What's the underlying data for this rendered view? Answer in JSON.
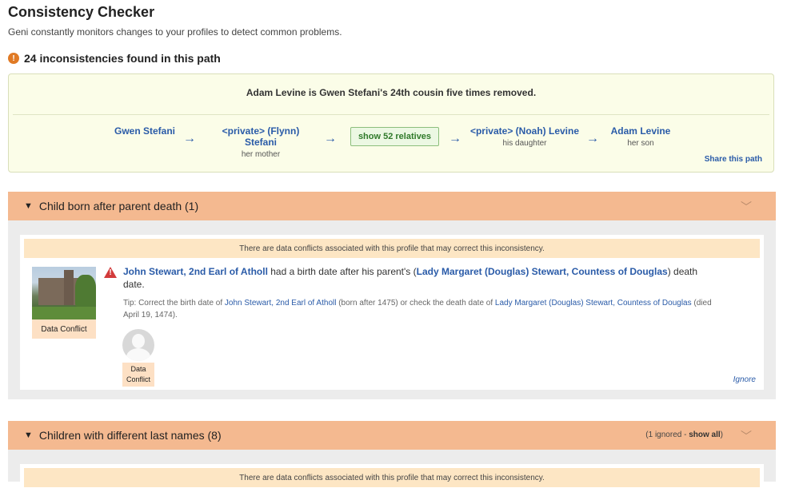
{
  "page": {
    "title": "Consistency Checker",
    "subtitle": "Geni constantly monitors changes to your profiles to detect common problems.",
    "count_text": "24 inconsistencies found in this path"
  },
  "path": {
    "headline": "Adam Levine is Gwen Stefani's 24th cousin five times removed.",
    "people": [
      {
        "name": "Gwen Stefani",
        "relation": ""
      },
      {
        "name": "<private> (Flynn) Stefani",
        "relation": "her mother"
      },
      {
        "name": "<private> (Noah) Levine",
        "relation": "his daughter"
      },
      {
        "name": "Adam Levine",
        "relation": "her son"
      }
    ],
    "show_relatives_label": "show 52 relatives",
    "share_label": "Share this path",
    "arrow": "→"
  },
  "sections": [
    {
      "title": "Child born after parent death (1)",
      "notice": "There are data conflicts associated with this profile that may correct this inconsistency.",
      "photo_label": "Data Conflict",
      "message": {
        "subject": "John Stewart, 2nd Earl of Atholl",
        "text1": " had a birth date after his parent's (",
        "parent": "Lady Margaret (Douglas) Stewart, Countess of Douglas",
        "text2": ") death date."
      },
      "tip": {
        "prefix": "Tip: Correct the birth date of ",
        "subject": "John Stewart, 2nd Earl of Atholl",
        "mid": " (born after 1475) or check the death date of ",
        "parent": "Lady Margaret (Douglas) Stewart, Countess of Douglas",
        "suffix": " (died April 19, 1474)."
      },
      "avatar_label": "Data Conflict",
      "ignore_label": "Ignore"
    },
    {
      "title": "Children with different last names (8)",
      "ignored_count": "(1 ignored - ",
      "show_all": "show all",
      "ignored_close": ")",
      "notice": "There are data conflicts associated with this profile that may correct this inconsistency."
    }
  ],
  "colors": {
    "accent_link": "#2a5ba8",
    "section_header": "#f4b990",
    "notice_bg": "#fde6c4",
    "warning": "#e07a25",
    "alert": "#d23b3b"
  }
}
